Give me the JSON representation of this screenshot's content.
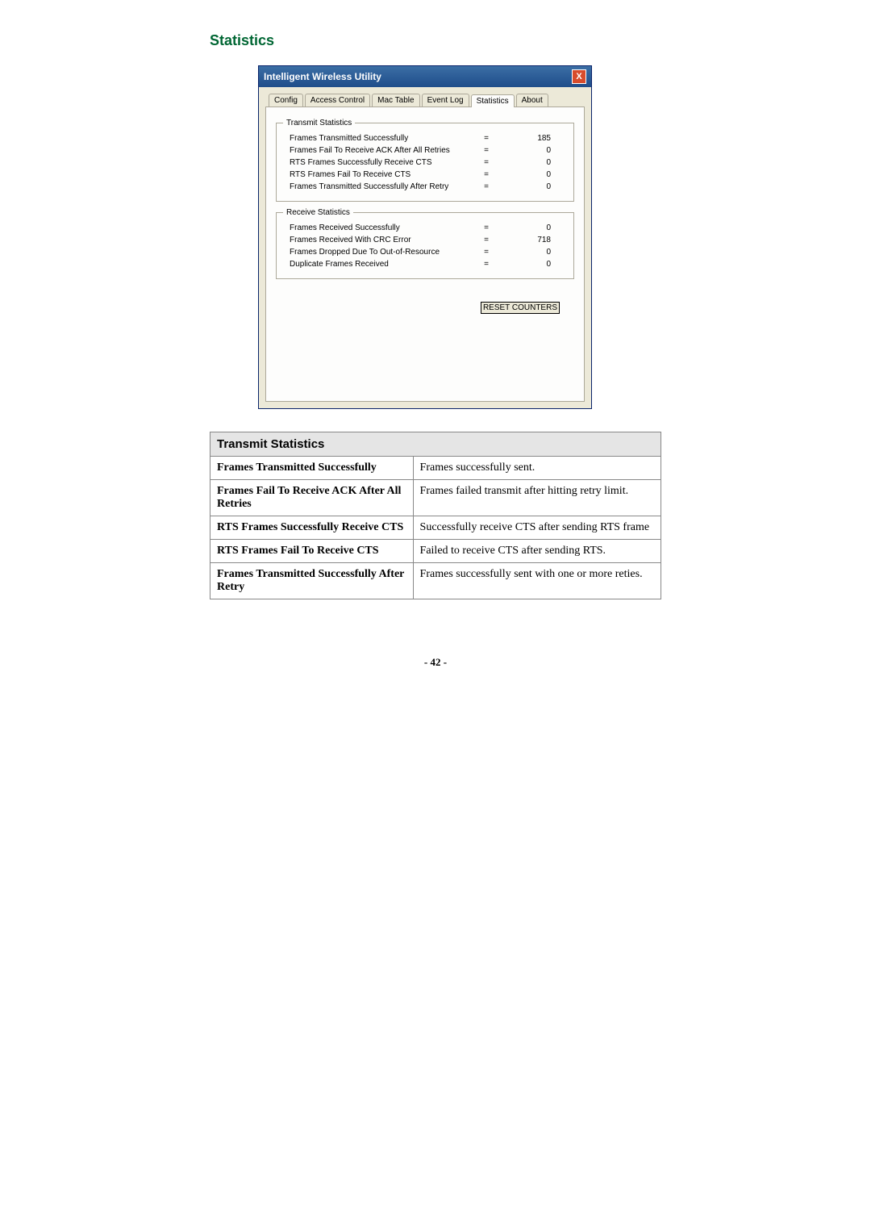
{
  "pageTitle": "Statistics",
  "pageNumber": "- 42 -",
  "window": {
    "title": "Intelligent Wireless Utility",
    "tabs": [
      "Config",
      "Access Control",
      "Mac Table",
      "Event Log",
      "Statistics",
      "About"
    ],
    "activeTab": "Statistics",
    "resetButton": "RESET COUNTERS"
  },
  "transmitStatistics": {
    "legend": "Transmit Statistics",
    "rows": [
      {
        "label": "Frames Transmitted Successfully",
        "value": "185"
      },
      {
        "label": "Frames Fail To Receive ACK After All Retries",
        "value": "0"
      },
      {
        "label": "RTS Frames Successfully Receive CTS",
        "value": "0"
      },
      {
        "label": "RTS Frames Fail To Receive CTS",
        "value": "0"
      },
      {
        "label": "Frames Transmitted Successfully After Retry",
        "value": "0"
      }
    ]
  },
  "receiveStatistics": {
    "legend": "Receive Statistics",
    "rows": [
      {
        "label": "Frames Received Successfully",
        "value": "0"
      },
      {
        "label": "Frames Received With CRC Error",
        "value": "718"
      },
      {
        "label": "Frames Dropped Due To Out-of-Resource",
        "value": "0"
      },
      {
        "label": "Duplicate Frames Received",
        "value": "0"
      }
    ]
  },
  "table": {
    "header": "Transmit Statistics",
    "rows": [
      {
        "label": "Frames Transmitted Successfully",
        "desc": "Frames successfully sent."
      },
      {
        "label": "Frames Fail To Receive ACK After All Retries",
        "desc": "Frames failed transmit after hitting retry limit."
      },
      {
        "label": "RTS Frames Successfully Receive CTS",
        "desc": "Successfully receive CTS after sending RTS frame"
      },
      {
        "label": "RTS Frames Fail To Receive CTS",
        "desc": "Failed to receive CTS after sending RTS."
      },
      {
        "label": "Frames Transmitted Successfully After Retry",
        "desc": "Frames successfully sent with one or more reties."
      }
    ]
  }
}
